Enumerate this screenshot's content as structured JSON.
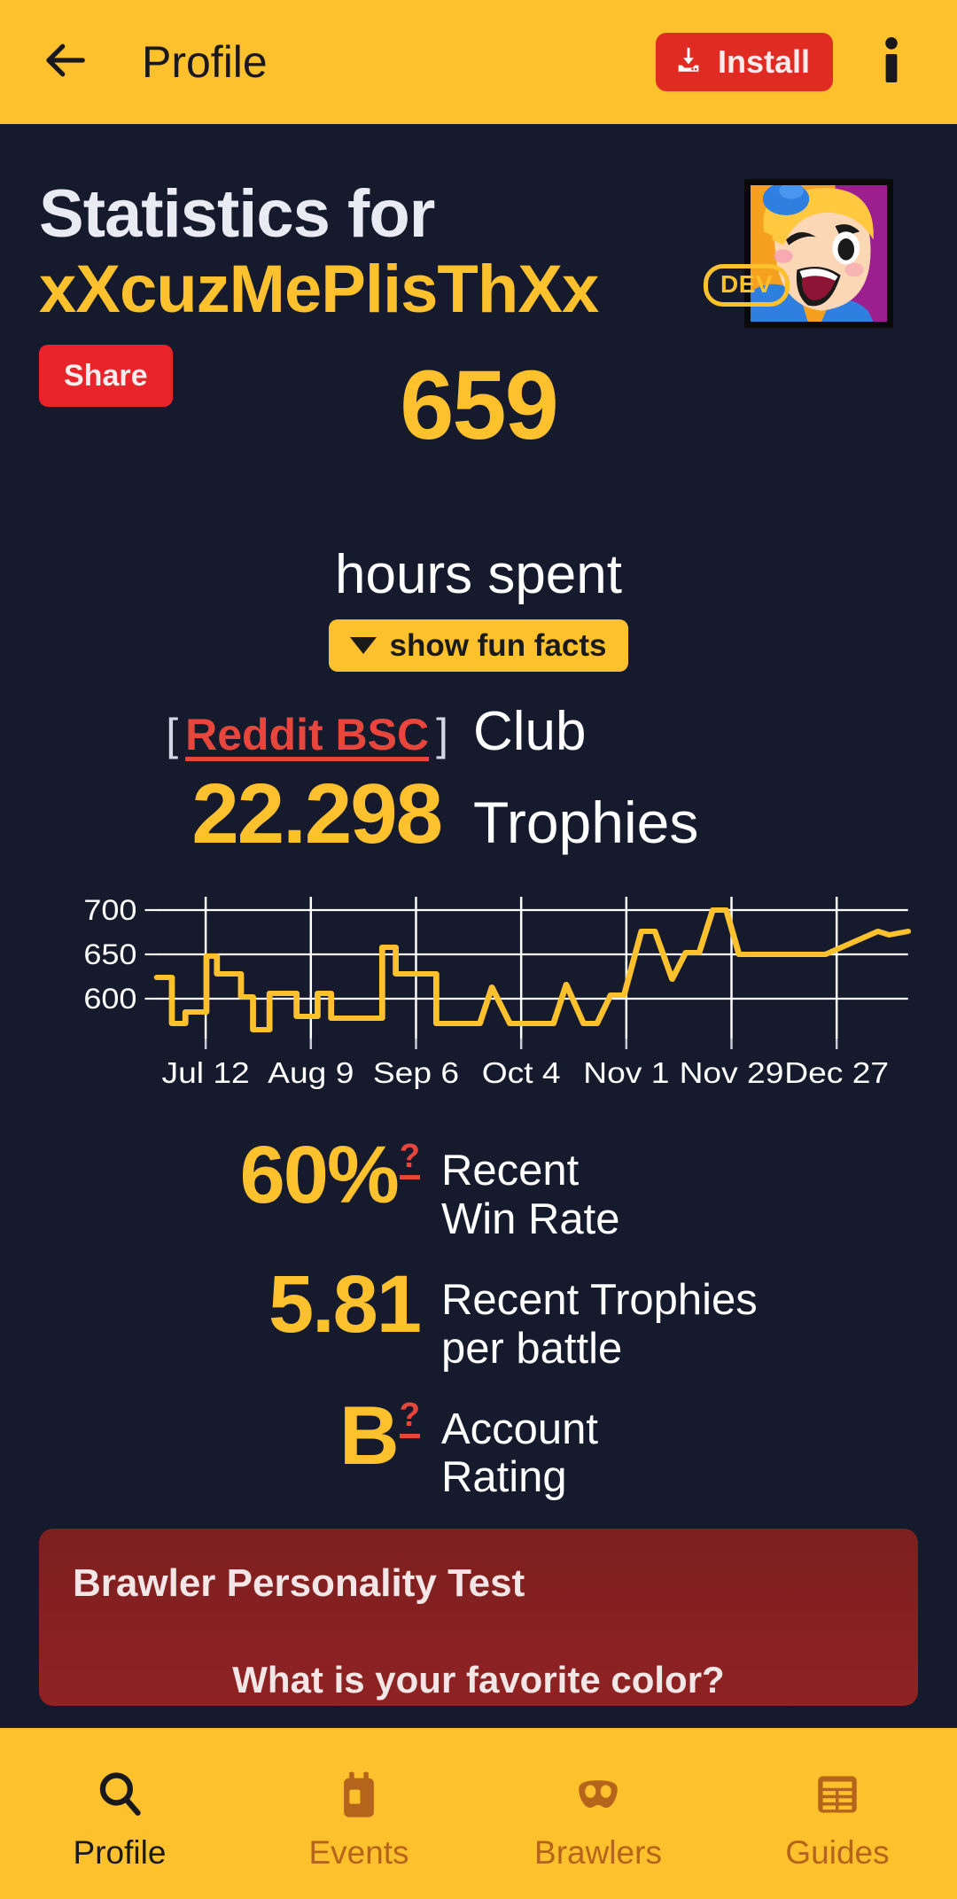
{
  "topbar": {
    "back_icon": "arrow-left-icon",
    "title": "Profile",
    "install_label": "Install",
    "install_icon": "download-install-icon",
    "info_icon": "info-icon"
  },
  "header": {
    "line1": "Statistics for",
    "username": "xXcuzMePlisThXx",
    "dev_badge": "DEV",
    "avatar_alt": "player-avatar"
  },
  "summary": {
    "share_label": "Share",
    "hours_value": "659",
    "hours_label": "hours spent",
    "fun_facts_label": "show fun facts",
    "fun_facts_caret": "▼"
  },
  "club": {
    "bracket_open": "[",
    "club_name": "Reddit BSC",
    "bracket_close": "]",
    "club_label": "Club",
    "trophies_value": "22.298",
    "trophies_label": "Trophies"
  },
  "metrics": [
    {
      "value": "60%",
      "has_help": true,
      "label": "Recent\nWin Rate",
      "label_l1": "Recent",
      "label_l2": "Win Rate"
    },
    {
      "value": "5.81",
      "has_help": false,
      "label_l1": "Recent Trophies",
      "label_l2": "per battle"
    },
    {
      "value": "B",
      "has_help": true,
      "label_l1": "Account",
      "label_l2": "Rating"
    }
  ],
  "help_marker": "?",
  "personality": {
    "title": "Brawler Personality Test",
    "question": "What is your favorite color?"
  },
  "bottom_nav": [
    {
      "label": "Profile",
      "icon": "search-icon",
      "active": true
    },
    {
      "label": "Events",
      "icon": "ticket-icon",
      "active": false
    },
    {
      "label": "Brawlers",
      "icon": "mask-icon",
      "active": false
    },
    {
      "label": "Guides",
      "icon": "list-icon",
      "active": false
    }
  ],
  "colors": {
    "brand_yellow": "#fcc12c",
    "background": "#151a2d",
    "accent_red": "#e8232a",
    "link_red": "#e8453c",
    "card_red": "#8f2222",
    "text_white": "#ffffff"
  },
  "chart_data": {
    "type": "line",
    "title": "",
    "xlabel": "",
    "ylabel": "",
    "ylim": [
      555,
      715
    ],
    "yticks": [
      600,
      650,
      700
    ],
    "ytick_labels": [
      "600",
      "650",
      "700"
    ],
    "grid": true,
    "legend": "none",
    "line_color": "#fcc12c",
    "xtick_labels": [
      "Jul 12",
      "Aug 9",
      "Sep 6",
      "Oct 4",
      "Nov 1",
      "Nov 29",
      "Dec 27"
    ],
    "xtick_positions": [
      0.065,
      0.205,
      0.345,
      0.485,
      0.625,
      0.765,
      0.905
    ],
    "series": [
      {
        "name": "Trophies",
        "x": [
          0.0,
          0.02,
          0.02,
          0.038,
          0.038,
          0.052,
          0.052,
          0.066,
          0.066,
          0.08,
          0.08,
          0.094,
          0.094,
          0.112,
          0.112,
          0.128,
          0.128,
          0.15,
          0.15,
          0.168,
          0.168,
          0.186,
          0.186,
          0.2,
          0.2,
          0.214,
          0.214,
          0.232,
          0.232,
          0.25,
          0.25,
          0.268,
          0.268,
          0.286,
          0.286,
          0.3,
          0.3,
          0.318,
          0.318,
          0.336,
          0.336,
          0.354,
          0.354,
          0.372,
          0.372,
          0.4,
          0.4,
          0.43,
          0.446,
          0.446,
          0.47,
          0.47,
          0.528,
          0.528,
          0.545,
          0.545,
          0.568,
          0.568,
          0.586,
          0.586,
          0.604,
          0.604,
          0.622,
          0.622,
          0.645,
          0.645,
          0.663,
          0.663,
          0.686,
          0.686,
          0.704,
          0.704,
          0.722,
          0.722,
          0.74,
          0.74,
          0.758,
          0.758,
          0.775,
          0.775,
          0.793,
          0.793,
          0.812,
          0.812,
          0.83,
          0.83,
          0.852,
          0.852,
          0.87,
          0.87,
          0.89,
          0.89,
          0.96,
          0.96,
          0.975,
          0.975,
          1.0
        ],
        "y": [
          624,
          624,
          572,
          572,
          585,
          585,
          585,
          585,
          648,
          648,
          628,
          628,
          628,
          628,
          602,
          602,
          565,
          565,
          606,
          606,
          606,
          606,
          580,
          580,
          580,
          580,
          606,
          606,
          578,
          578,
          578,
          578,
          578,
          578,
          578,
          578,
          658,
          658,
          628,
          628,
          628,
          628,
          628,
          628,
          572,
          572,
          572,
          572,
          613,
          613,
          572,
          572,
          572,
          572,
          616,
          616,
          572,
          572,
          572,
          572,
          604,
          604,
          604,
          604,
          676,
          676,
          676,
          676,
          622,
          622,
          652,
          652,
          652,
          652,
          700,
          700,
          700,
          700,
          650,
          650,
          650,
          650,
          650,
          650,
          650,
          650,
          650,
          650,
          650,
          650,
          650,
          650,
          676,
          676,
          672,
          672,
          676
        ],
        "description": "Step-style trophy history from Jul 12 through Dec 27, ranging roughly 565 to 700 trophies, trending upward at the end."
      }
    ]
  }
}
